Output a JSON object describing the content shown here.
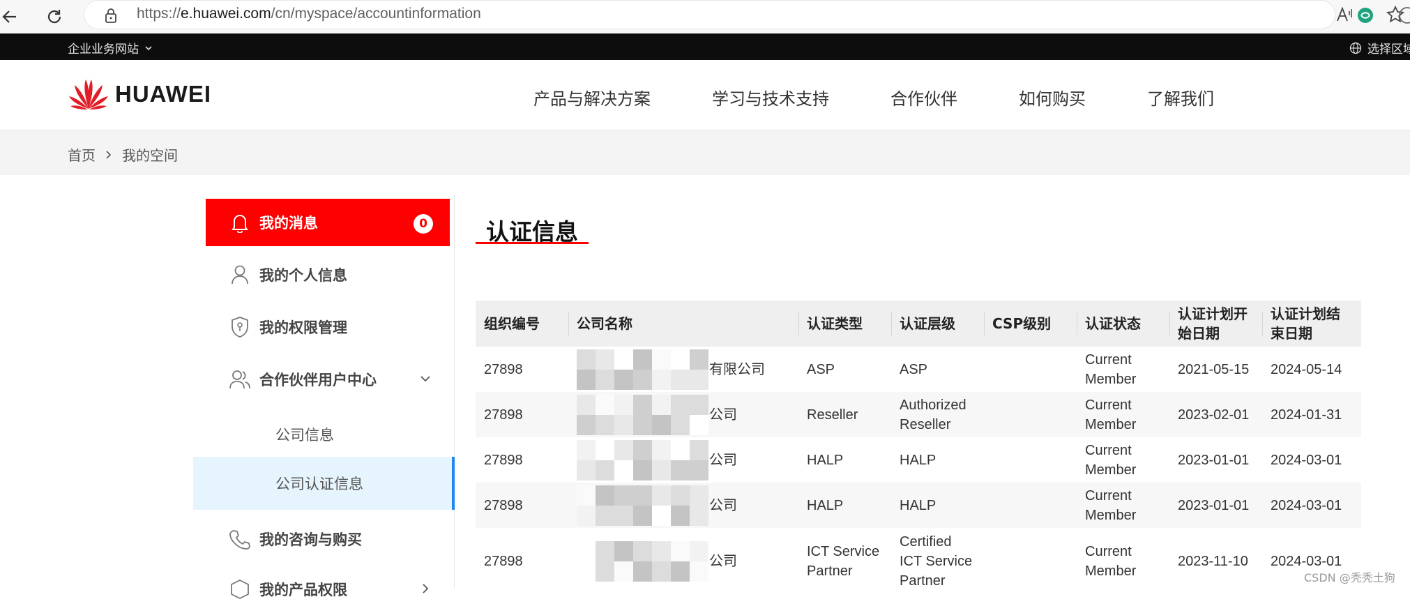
{
  "browser": {
    "url_prefix": "https://",
    "url_domain": "e.huawei.com",
    "url_path": "/cn/myspace/accountinformation"
  },
  "topstrip": {
    "left_label": "企业业务网站",
    "right_label": "选择区域"
  },
  "header": {
    "brand": "HUAWEI",
    "nav": [
      "产品与解决方案",
      "学习与技术支持",
      "合作伙伴",
      "如何购买",
      "了解我们"
    ]
  },
  "breadcrumb": {
    "home": "首页",
    "current": "我的空间"
  },
  "sidebar": {
    "messages_label": "我的消息",
    "messages_count": "0",
    "profile_label": "我的个人信息",
    "permissions_label": "我的权限管理",
    "partner_center_label": "合作伙伴用户中心",
    "company_info_label": "公司信息",
    "company_cert_label": "公司认证信息",
    "consult_label": "我的咨询与购买",
    "product_label": "我的产品权限"
  },
  "content": {
    "title": "认证信息"
  },
  "table": {
    "headers": [
      "组织编号",
      "公司名称",
      "认证类型",
      "认证层级",
      "CSP级别",
      "认证状态",
      "认证计划开始日期",
      "认证计划结束日期"
    ],
    "rows": [
      {
        "org": "27898",
        "company_suffix": "有限公司",
        "type": "ASP",
        "level": "ASP",
        "csp": "",
        "status": "Current Member",
        "start": "2021-05-15",
        "end": "2024-05-14"
      },
      {
        "org": "27898",
        "company_suffix": "公司",
        "type": "Reseller",
        "level": "Authorized Reseller",
        "csp": "",
        "status": "Current Member",
        "start": "2023-02-01",
        "end": "2024-01-31"
      },
      {
        "org": "27898",
        "company_suffix": "公司",
        "type": "HALP",
        "level": "HALP",
        "csp": "",
        "status": "Current Member",
        "start": "2023-01-01",
        "end": "2024-03-01"
      },
      {
        "org": "27898",
        "company_suffix": "公司",
        "type": "HALP",
        "level": "HALP",
        "csp": "",
        "status": "Current Member",
        "start": "2023-01-01",
        "end": "2024-03-01"
      },
      {
        "org": "27898",
        "company_suffix": "公司",
        "type": "ICT Service Partner",
        "level": "Certified ICT Service Partner",
        "csp": "",
        "status": "Current Member",
        "start": "2023-11-10",
        "end": "2024-03-01"
      }
    ]
  },
  "watermark": "CSDN @秃秃土狗",
  "colors": {
    "brand_red": "#fe0000",
    "selected_bg": "#e6f4fd",
    "selected_border": "#1f86f0"
  }
}
